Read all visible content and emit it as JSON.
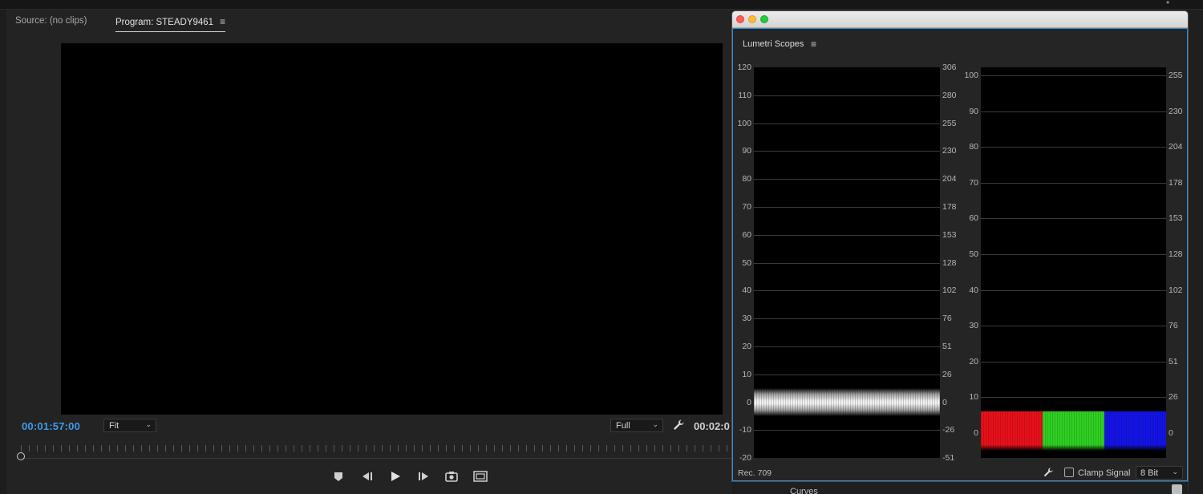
{
  "program_monitor": {
    "source_tab": "Source: (no clips)",
    "program_tab": "Program: STEADY9461",
    "current_timecode": "00:01:57:00",
    "duration_timecode": "00:02:0",
    "zoom_dropdown": {
      "selected": "Fit"
    },
    "resolution_dropdown": {
      "selected": "Full"
    },
    "transport_icons": [
      "add-marker-icon",
      "step-back-icon",
      "play-icon",
      "step-forward-icon",
      "export-frame-icon",
      "safe-margins-icon"
    ]
  },
  "lumetri": {
    "title": "Lumetri Scopes",
    "waveform": {
      "left_scale": [
        "120",
        "110",
        "100",
        "90",
        "80",
        "70",
        "60",
        "50",
        "40",
        "30",
        "20",
        "10",
        "0",
        "-10",
        "-20"
      ],
      "right_scale": [
        "306",
        "280",
        "255",
        "230",
        "204",
        "178",
        "153",
        "128",
        "102",
        "76",
        "51",
        "26",
        "0",
        "-26",
        "-51"
      ],
      "trace_color": "#f0f0f0",
      "trace_ire_range": [
        -5,
        5
      ]
    },
    "parade": {
      "left_scale": [
        "100",
        "90",
        "80",
        "70",
        "60",
        "50",
        "40",
        "30",
        "20",
        "10",
        "0"
      ],
      "right_scale": [
        "255",
        "230",
        "204",
        "178",
        "153",
        "128",
        "102",
        "76",
        "51",
        "26",
        "0"
      ],
      "channels": [
        {
          "name": "R",
          "color": "#e8101a"
        },
        {
          "name": "G",
          "color": "#2fcf22"
        },
        {
          "name": "B",
          "color": "#1414e6"
        }
      ],
      "trace_range": [
        -5,
        6
      ]
    },
    "footer": {
      "colorspace": "Rec. 709",
      "clamp_label": "Clamp Signal",
      "clamp_checked": false,
      "bit_depth": "8 Bit"
    }
  },
  "right_panel": {
    "curves_label": "Curves"
  },
  "colors": {
    "accent_timecode": "#3d9be9",
    "focus_border": "#2f8fd6"
  }
}
